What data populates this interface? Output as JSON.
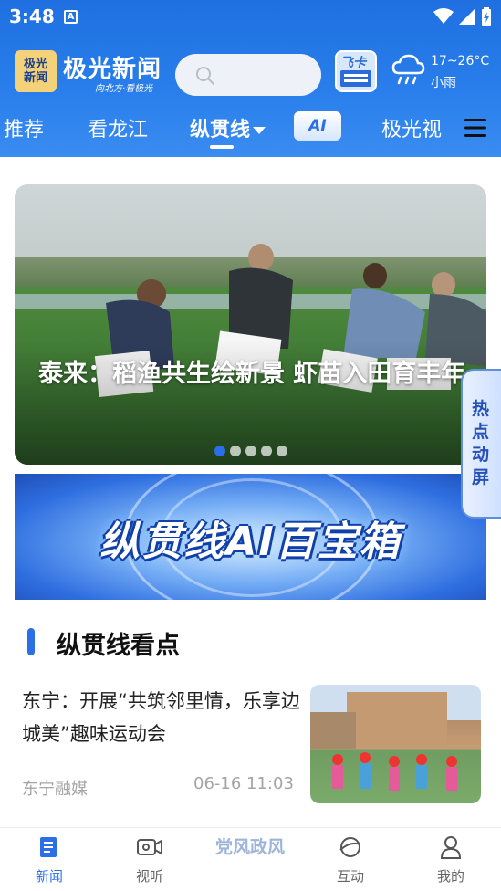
{
  "status_bar": {
    "time": "3:48",
    "a_indicator": "A"
  },
  "header": {
    "logo_badge": [
      "极光",
      "新闻"
    ],
    "app_title": "极光新闻",
    "slogan": "向北方·看极光",
    "feika_label": "飞卡",
    "weather": {
      "temp": "17~26°C",
      "desc": "小雨"
    }
  },
  "tabs": [
    {
      "label": "推荐",
      "active": false
    },
    {
      "label": "看龙江",
      "active": false
    },
    {
      "label": "纵贯线",
      "active": true
    },
    {
      "label": "AI",
      "active": false
    },
    {
      "label": "极光视",
      "active": false
    }
  ],
  "banner": {
    "title": "泰来：稻渔共生绘新景 虾苗入田育丰年",
    "slide_count": 5,
    "active_slide": 1
  },
  "hot_screen": {
    "label": "热点动屏"
  },
  "ai_banner": {
    "text": "纵贯线AI百宝箱"
  },
  "section": {
    "title": "纵贯线看点"
  },
  "news": [
    {
      "title": "东宁：开展“共筑邻里情，乐享边城美”趣味运动会",
      "source": "东宁融媒",
      "time": "06-16 11:03"
    }
  ],
  "bottom_nav": [
    {
      "label": "新闻",
      "icon": "news-icon",
      "active": true
    },
    {
      "label": "视听",
      "icon": "video-icon",
      "active": false
    },
    {
      "label": "党风政风",
      "icon": "special",
      "active": false
    },
    {
      "label": "互动",
      "icon": "planet-icon",
      "active": false
    },
    {
      "label": "我的",
      "icon": "user-icon",
      "active": false
    }
  ],
  "colors": {
    "accent": "#2b6fe6",
    "header_blue": "#2a7fec"
  }
}
